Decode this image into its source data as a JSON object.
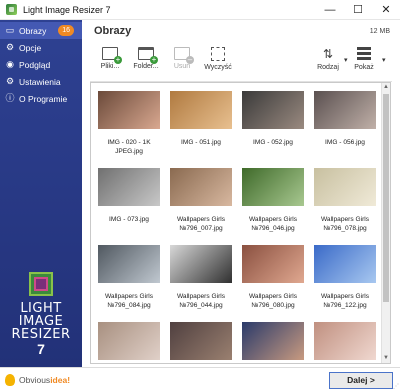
{
  "window": {
    "title": "Light Image Resizer 7",
    "minimize_glyph": "—",
    "maximize_glyph": "☐",
    "close_glyph": "✕"
  },
  "sidebar": {
    "items": [
      {
        "label": "Obrazy",
        "icon": "images-icon",
        "glyph": "▭",
        "badge": "16",
        "active": true
      },
      {
        "label": "Opcje",
        "icon": "options-icon",
        "glyph": "⚙",
        "active": false
      },
      {
        "label": "Podgląd",
        "icon": "preview-eye-icon",
        "glyph": "◉",
        "active": false
      },
      {
        "label": "Ustawienia",
        "icon": "settings-icon",
        "glyph": "⚙",
        "active": false
      },
      {
        "label": "O Programie",
        "icon": "info-icon",
        "glyph": "ⓘ",
        "active": false
      }
    ],
    "brand": {
      "line1": "LIGHT",
      "line2": "IMAGE",
      "line3": "RESIZER",
      "version": "7"
    }
  },
  "main": {
    "title": "Obrazy",
    "size": "12 MB",
    "toolbar": {
      "files": "Pliki...",
      "folder": "Folder...",
      "remove": "Usuń",
      "clear": "Wyczyść",
      "sort": "Rodzaj",
      "view": "Pokaż",
      "caret": "▾"
    },
    "thumbnails": [
      {
        "caption": "IMG - 020 - 1K JPEG.jpg",
        "colors": [
          "#6b4a3a",
          "#d9a890"
        ]
      },
      {
        "caption": "IMG - 051.jpg",
        "colors": [
          "#b07a40",
          "#e8c090"
        ]
      },
      {
        "caption": "IMG - 052.jpg",
        "colors": [
          "#3a3a3a",
          "#9a8a80"
        ]
      },
      {
        "caption": "IMG - 056.jpg",
        "colors": [
          "#5a5050",
          "#c0b0a8"
        ]
      },
      {
        "caption": "IMG - 073.jpg",
        "colors": [
          "#707070",
          "#c8c8c8"
        ]
      },
      {
        "caption": "Wallpapers Girls №796_007.jpg",
        "colors": [
          "#8a6a50",
          "#d8b8a0"
        ]
      },
      {
        "caption": "Wallpapers Girls №796_046.jpg",
        "colors": [
          "#3f6a2a",
          "#a8c890"
        ]
      },
      {
        "caption": "Wallpapers Girls №796_078.jpg",
        "colors": [
          "#c8c0a0",
          "#f0ead8"
        ]
      },
      {
        "caption": "Wallpapers Girls №796_084.jpg",
        "colors": [
          "#505860",
          "#c0c8d0"
        ]
      },
      {
        "caption": "Wallpapers Girls №796_044.jpg",
        "colors": [
          "#d8d8d8",
          "#303030"
        ]
      },
      {
        "caption": "Wallpapers Girls №796_080.jpg",
        "colors": [
          "#8a5040",
          "#e0a890"
        ]
      },
      {
        "caption": "Wallpapers Girls №796_122.jpg",
        "colors": [
          "#3a6ac8",
          "#a8c8f0"
        ]
      },
      {
        "caption": "",
        "colors": [
          "#a89080",
          "#e0d0c8"
        ]
      },
      {
        "caption": "",
        "colors": [
          "#504040",
          "#9a8070"
        ]
      },
      {
        "caption": "",
        "colors": [
          "#2a3a6a",
          "#c89a80"
        ]
      },
      {
        "caption": "",
        "colors": [
          "#c09080",
          "#f0d8d0"
        ]
      }
    ]
  },
  "footer": {
    "logo_prefix": "Obvious",
    "logo_suffix": "idea!",
    "next_button": "Dalej >"
  }
}
